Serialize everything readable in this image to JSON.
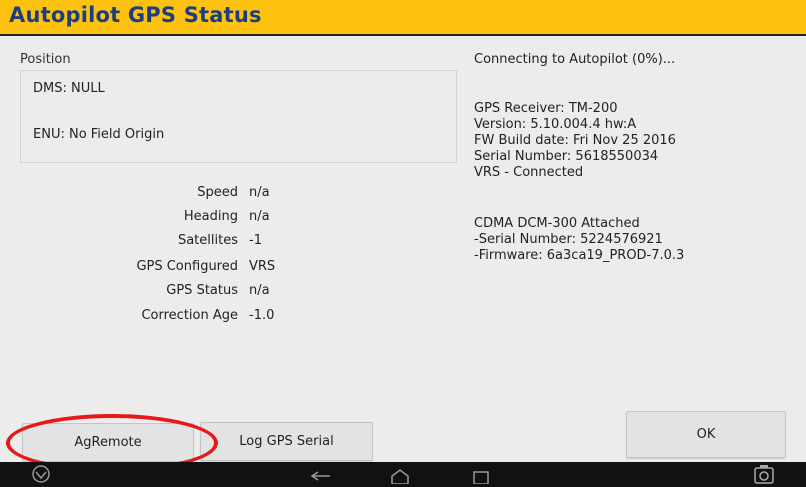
{
  "window": {
    "title": "Autopilot GPS Status"
  },
  "position": {
    "label": "Position",
    "dms": "DMS: NULL",
    "enu": "ENU: No Field Origin"
  },
  "stats": [
    {
      "label": "Speed",
      "value": "n/a"
    },
    {
      "label": "Heading",
      "value": "n/a"
    },
    {
      "label": "Satellites",
      "value": "-1"
    },
    {
      "label": "GPS Configured",
      "value": "VRS"
    },
    {
      "label": "GPS Status",
      "value": "n/a"
    },
    {
      "label": "Correction Age",
      "value": "-1.0"
    }
  ],
  "connection": {
    "status": "Connecting to Autopilot (0%)..."
  },
  "receiver": {
    "lines": [
      "GPS Receiver: TM-200",
      "Version: 5.10.004.4 hw:A",
      "FW Build date: Fri Nov 25 2016",
      "Serial Number: 5618550034",
      "VRS - Connected"
    ]
  },
  "modem": {
    "lines": [
      "CDMA DCM-300 Attached",
      "-Serial Number: 5224576921",
      "-Firmware: 6a3ca19_PROD-7.0.3"
    ]
  },
  "buttons": {
    "agremote": "AgRemote",
    "log_gps_serial": "Log GPS Serial",
    "ok": "OK"
  },
  "navbar": {
    "icons": [
      "logo-icon",
      "back-icon",
      "home-icon",
      "recents-icon",
      "screenshot-icon"
    ]
  },
  "colors": {
    "title_bar": "#fcc20f",
    "title_text": "#1d3e7e",
    "annotation": "#e41a1a"
  }
}
